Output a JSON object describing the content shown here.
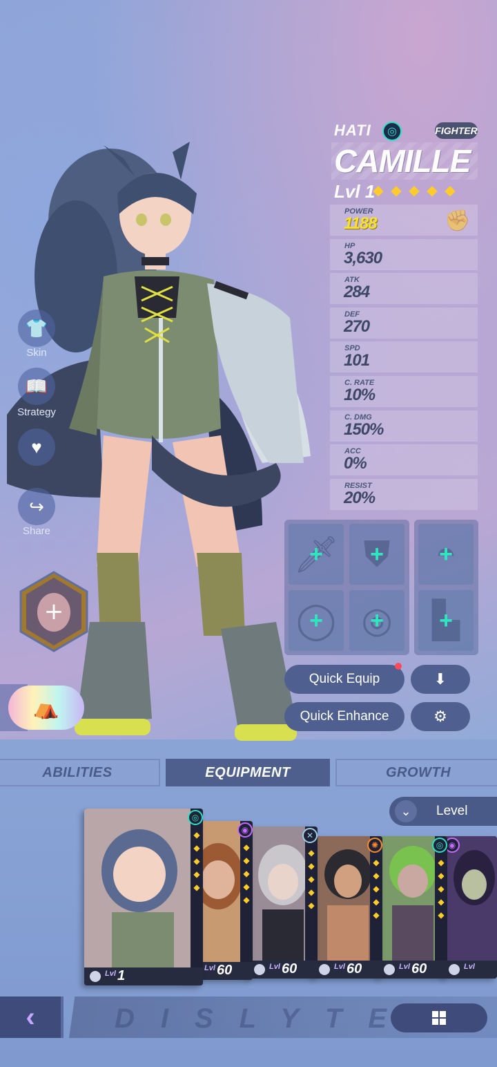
{
  "hero": {
    "faction": "HATI",
    "class": "FIGHTER",
    "name": "CAMILLE",
    "level": "Lvl 1",
    "stars": 5
  },
  "stats": [
    {
      "label": "POWER",
      "value": "1188"
    },
    {
      "label": "HP",
      "value": "3,630"
    },
    {
      "label": "ATK",
      "value": "284"
    },
    {
      "label": "DEF",
      "value": "270"
    },
    {
      "label": "SPD",
      "value": "101"
    },
    {
      "label": "C. RATE",
      "value": "10%"
    },
    {
      "label": "C. DMG",
      "value": "150%"
    },
    {
      "label": "ACC",
      "value": "0%"
    },
    {
      "label": "RESIST",
      "value": "20%"
    }
  ],
  "side_menu": {
    "skin": "Skin",
    "strategy": "Strategy",
    "share": "Share"
  },
  "buttons": {
    "quick_equip": "Quick Equip",
    "quick_enhance": "Quick Enhance"
  },
  "tabs": {
    "abilities": "ABILITIES",
    "equipment": "EQUIPMENT",
    "growth": "GROWTH"
  },
  "sort": {
    "label": "Level"
  },
  "cards": [
    {
      "lvl_prefix": "Lvl",
      "lvl": "1",
      "elem_color": "#2fe0c5"
    },
    {
      "lvl_prefix": "Lvl",
      "lvl": "60",
      "elem_color": "#c56bff"
    },
    {
      "lvl_prefix": "Lvl",
      "lvl": "60",
      "elem_color": "#9fd0e6"
    },
    {
      "lvl_prefix": "Lvl",
      "lvl": "60",
      "elem_color": "#ff8a2b"
    },
    {
      "lvl_prefix": "Lvl",
      "lvl": "60",
      "elem_color": "#2fe0c5"
    },
    {
      "lvl_prefix": "Lvl",
      "lvl": "",
      "elem_color": "#c56bff"
    }
  ],
  "logo": "DISLYTE",
  "colors": {
    "accent_teal": "#2fe6c0",
    "power_yellow": "#f7e12d",
    "button_bg": "#4f5f8f"
  }
}
